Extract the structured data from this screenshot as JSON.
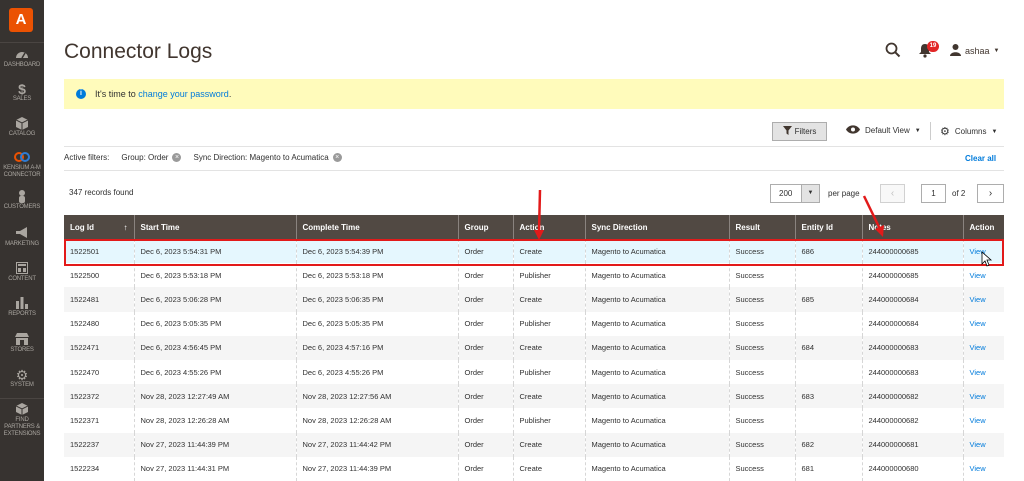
{
  "sidebar": {
    "logo_letter": "A",
    "items": [
      {
        "label": "Dashboard",
        "icon": "speedometer-icon"
      },
      {
        "label": "Sales",
        "icon": "dollar-icon"
      },
      {
        "label": "Catalog",
        "icon": "cube-icon"
      },
      {
        "label": "Kensium A-M Connector",
        "icon": "connector-icon"
      },
      {
        "label": "Customers",
        "icon": "person-icon"
      },
      {
        "label": "Marketing",
        "icon": "megaphone-icon"
      },
      {
        "label": "Content",
        "icon": "layout-icon"
      },
      {
        "label": "Reports",
        "icon": "bar-chart-icon"
      },
      {
        "label": "Stores",
        "icon": "store-icon"
      },
      {
        "label": "System",
        "icon": "gear-icon"
      },
      {
        "label": "Find Partners & Extensions",
        "icon": "box-icon"
      }
    ]
  },
  "header": {
    "title": "Connector Logs",
    "notification_count": "19",
    "user": "ashaa"
  },
  "notice": {
    "text": "It's time to",
    "link": "change your password",
    "suffix": "."
  },
  "toolbar": {
    "filters_label": "Filters",
    "view_label": "Default View",
    "columns_label": "Columns"
  },
  "active_filters": {
    "label": "Active filters:",
    "chips": [
      "Group: Order",
      "Sync Direction: Magento to Acumatica"
    ],
    "clear_all": "Clear all"
  },
  "pager": {
    "records": "347 records found",
    "per_page_value": "200",
    "per_page_label": "per page",
    "current_page": "1",
    "of_pages": "of 2"
  },
  "table": {
    "columns": [
      "Log Id",
      "Start Time",
      "Complete Time",
      "Group",
      "Action",
      "Sync Direction",
      "Result",
      "Entity Id",
      "Notes",
      "Action"
    ],
    "rows": [
      [
        "1522501",
        "Dec 6, 2023 5:54:31 PM",
        "Dec 6, 2023 5:54:39 PM",
        "Order",
        "Create",
        "Magento to Acumatica",
        "Success",
        "686",
        "244000000685",
        "View"
      ],
      [
        "1522500",
        "Dec 6, 2023 5:53:18 PM",
        "Dec 6, 2023 5:53:18 PM",
        "Order",
        "Publisher",
        "Magento to Acumatica",
        "Success",
        "",
        "244000000685",
        "View"
      ],
      [
        "1522481",
        "Dec 6, 2023 5:06:28 PM",
        "Dec 6, 2023 5:06:35 PM",
        "Order",
        "Create",
        "Magento to Acumatica",
        "Success",
        "685",
        "244000000684",
        "View"
      ],
      [
        "1522480",
        "Dec 6, 2023 5:05:35 PM",
        "Dec 6, 2023 5:05:35 PM",
        "Order",
        "Publisher",
        "Magento to Acumatica",
        "Success",
        "",
        "244000000684",
        "View"
      ],
      [
        "1522471",
        "Dec 6, 2023 4:56:45 PM",
        "Dec 6, 2023 4:57:16 PM",
        "Order",
        "Create",
        "Magento to Acumatica",
        "Success",
        "684",
        "244000000683",
        "View"
      ],
      [
        "1522470",
        "Dec 6, 2023 4:55:26 PM",
        "Dec 6, 2023 4:55:26 PM",
        "Order",
        "Publisher",
        "Magento to Acumatica",
        "Success",
        "",
        "244000000683",
        "View"
      ],
      [
        "1522372",
        "Nov 28, 2023 12:27:49 AM",
        "Nov 28, 2023 12:27:56 AM",
        "Order",
        "Create",
        "Magento to Acumatica",
        "Success",
        "683",
        "244000000682",
        "View"
      ],
      [
        "1522371",
        "Nov 28, 2023 12:26:28 AM",
        "Nov 28, 2023 12:26:28 AM",
        "Order",
        "Publisher",
        "Magento to Acumatica",
        "Success",
        "",
        "244000000682",
        "View"
      ],
      [
        "1522237",
        "Nov 27, 2023 11:44:39 PM",
        "Nov 27, 2023 11:44:42 PM",
        "Order",
        "Create",
        "Magento to Acumatica",
        "Success",
        "682",
        "244000000681",
        "View"
      ],
      [
        "1522234",
        "Nov 27, 2023 11:44:31 PM",
        "Nov 27, 2023 11:44:39 PM",
        "Order",
        "Create",
        "Magento to Acumatica",
        "Success",
        "681",
        "244000000680",
        "View"
      ]
    ]
  },
  "colors": {
    "brand": "#eb5202",
    "sidebar": "#373330",
    "table_header": "#514943",
    "link": "#007bdb",
    "annotation": "#e21a1a"
  }
}
